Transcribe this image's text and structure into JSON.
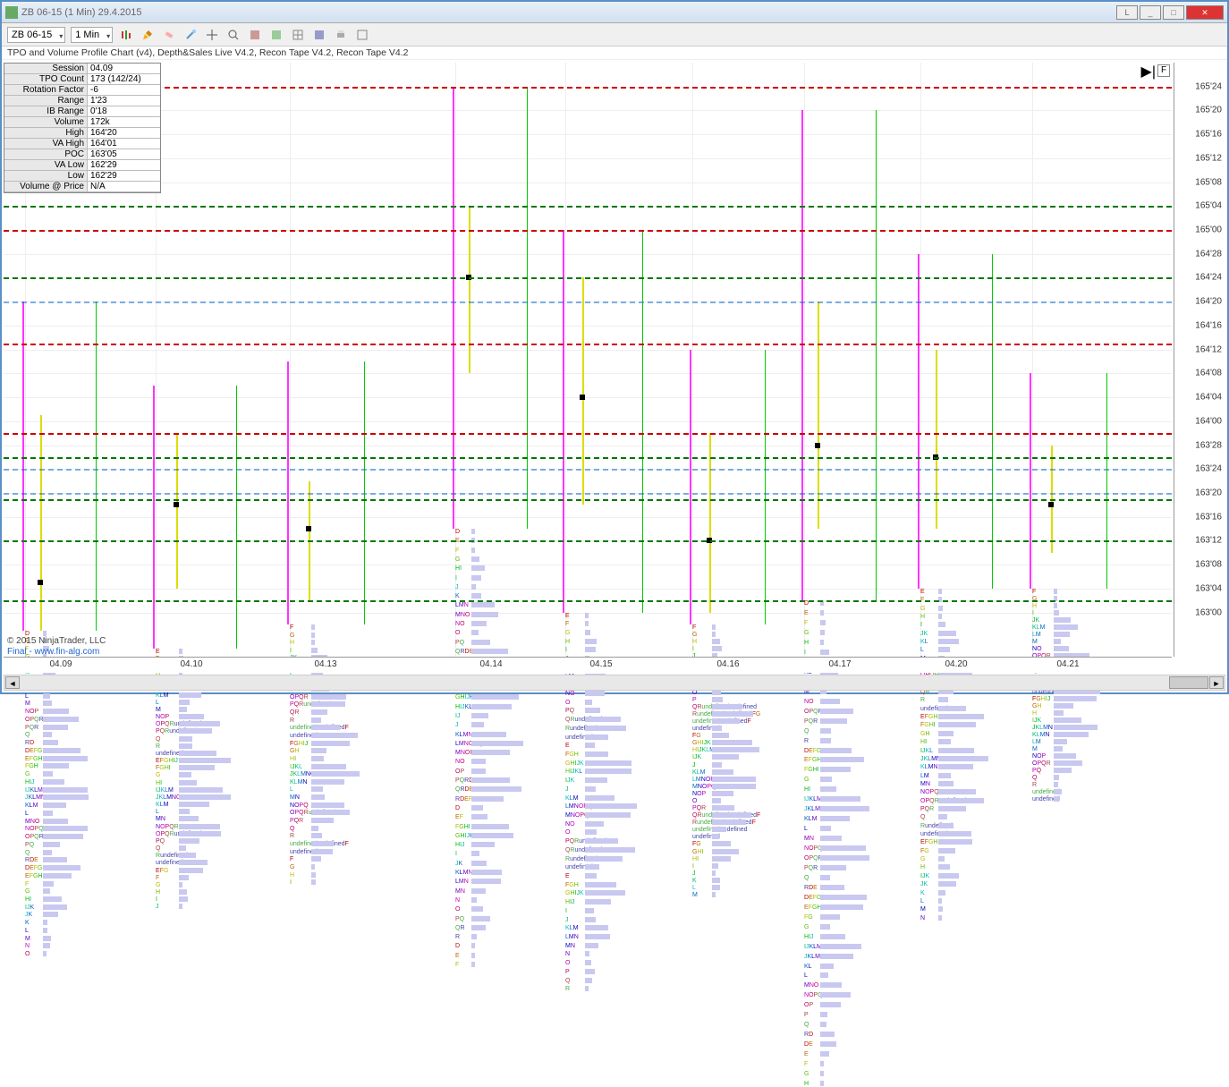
{
  "window": {
    "title": "ZB 06-15 (1 Min)  29.4.2015"
  },
  "toolbar": {
    "instrument": "ZB 06-15",
    "timeframe": "1 Min"
  },
  "info_strip": "TPO and Volume Profile Chart (v4), Depth&Sales Live V4.2, Recon Tape V4.2, Recon Tape V4.2",
  "stats": {
    "Session": "04.09",
    "TPO Count": "173 (142/24)",
    "Rotation Factor": "-6",
    "Range": "1'23",
    "IB Range": "0'18",
    "Volume": "172k",
    "High": "164'20",
    "VA High": "164'01",
    "POC": "163'05",
    "VA Low": "162'29",
    "Low": "162'29",
    "Volume @ Price": "N/A"
  },
  "copyright": "© 2015 NinjaTrader, LLC",
  "site": "Final - www.fin-alg.com",
  "f_label": "F",
  "chart_data": {
    "type": "profile",
    "title": "TPO and Volume Profile",
    "y_ticks": [
      "165'24",
      "165'20",
      "165'16",
      "165'12",
      "165'08",
      "165'04",
      "165'00",
      "164'28",
      "164'24",
      "164'20",
      "164'16",
      "164'12",
      "164'08",
      "164'04",
      "164'00",
      "163'28",
      "163'24",
      "163'20",
      "163'16",
      "163'12",
      "163'08",
      "163'04",
      "163'00"
    ],
    "x_ticks": [
      "04.09",
      "04.10",
      "04.13",
      "04.14",
      "04.15",
      "04.16",
      "04.17",
      "04.20",
      "04.21"
    ],
    "ref_lines": [
      {
        "price": "165'24",
        "color": "#c00"
      },
      {
        "price": "165'04",
        "color": "#070"
      },
      {
        "price": "165'00",
        "color": "#c00"
      },
      {
        "price": "164'24",
        "color": "#070"
      },
      {
        "price": "164'13",
        "color": "#c00"
      },
      {
        "price": "163'30",
        "color": "#c00"
      },
      {
        "price": "163'26",
        "color": "#070"
      },
      {
        "price": "163'19",
        "color": "#070"
      },
      {
        "price": "163'12",
        "color": "#070"
      },
      {
        "price": "163'02",
        "color": "#070"
      }
    ],
    "sessions": [
      {
        "date": "04.09",
        "x": 24,
        "low": "162'29",
        "high": "164'20",
        "poc": "163'05",
        "va_low": "162'29",
        "va_high": "164'01",
        "width_max": 55,
        "rows": 42,
        "tpo_w": 20
      },
      {
        "date": "04.10",
        "x": 170,
        "low": "162'26",
        "high": "164'06",
        "poc": "163'18",
        "va_low": "163'04",
        "va_high": "163'30",
        "width_max": 60,
        "rows": 36,
        "tpo_w": 26
      },
      {
        "date": "04.13",
        "x": 320,
        "low": "162'30",
        "high": "164'10",
        "poc": "163'14",
        "va_low": "163'02",
        "va_high": "163'22",
        "width_max": 55,
        "rows": 34,
        "tpo_w": 24
      },
      {
        "date": "04.14",
        "x": 505,
        "low": "163'14",
        "high": "165'24",
        "poc": "164'24",
        "va_low": "164'08",
        "va_high": "165'04",
        "width_max": 58,
        "rows": 48,
        "tpo_w": 18
      },
      {
        "date": "04.15",
        "x": 628,
        "low": "163'00",
        "high": "165'00",
        "poc": "164'04",
        "va_low": "163'18",
        "va_high": "164'24",
        "width_max": 60,
        "rows": 44,
        "tpo_w": 22
      },
      {
        "date": "04.16",
        "x": 770,
        "low": "162'30",
        "high": "164'12",
        "poc": "163'12",
        "va_low": "163'00",
        "va_high": "163'30",
        "width_max": 55,
        "rows": 38,
        "tpo_w": 22
      },
      {
        "date": "04.17",
        "x": 895,
        "low": "163'02",
        "high": "165'20",
        "poc": "163'28",
        "va_low": "163'14",
        "va_high": "164'20",
        "width_max": 58,
        "rows": 50,
        "tpo_w": 18
      },
      {
        "date": "04.20",
        "x": 1025,
        "low": "163'04",
        "high": "164'28",
        "poc": "163'26",
        "va_low": "163'14",
        "va_high": "164'12",
        "width_max": 56,
        "rows": 40,
        "tpo_w": 20
      },
      {
        "date": "04.21",
        "x": 1150,
        "low": "163'04",
        "high": "164'08",
        "poc": "163'18",
        "va_low": "163'10",
        "va_high": "163'28",
        "width_max": 55,
        "rows": 30,
        "tpo_w": 24
      }
    ]
  }
}
